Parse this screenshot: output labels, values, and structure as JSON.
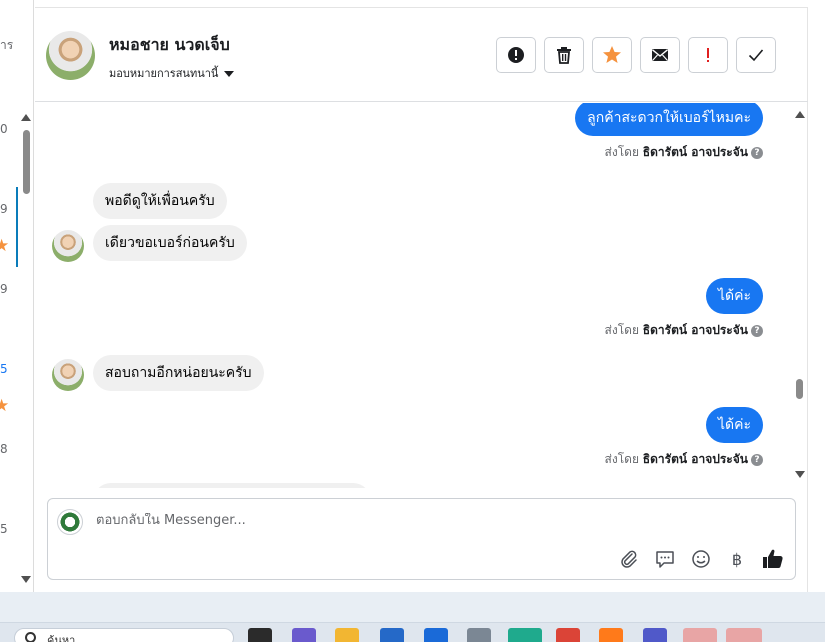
{
  "left_list": {
    "header_fragment": "าร",
    "row_times": [
      "0",
      "9",
      "9",
      "5",
      "8",
      "5"
    ],
    "blue_index": 3
  },
  "conversation": {
    "name": "หมอชาย นวดเจ็บ",
    "assign_label": "มอบหมายการสนทนานี้",
    "toolbar": {
      "spam_icon": "alert-circle-icon",
      "trash_icon": "trash-icon",
      "star_icon": "star-icon",
      "mail_icon": "envelope-icon",
      "important_icon": "exclamation-icon",
      "done_icon": "check-icon"
    }
  },
  "messages": [
    {
      "direction": "out",
      "text": "ลูกค้าสะดวกให้เบอร์ไหมคะ",
      "sent_prefix": "ส่งโดย",
      "sent_by": "ธิดารัตน์ อาจประจัน"
    },
    {
      "direction": "in",
      "text": "พอดีดูให้เพื่อนครับ"
    },
    {
      "direction": "in",
      "text": "เดียวขอเบอร์ก่อนครับ"
    },
    {
      "direction": "out",
      "text": "ได้ค่ะ",
      "sent_prefix": "ส่งโดย",
      "sent_by": "ธิดารัตน์ อาจประจัน"
    },
    {
      "direction": "in",
      "text": "สอบถามอีกหน่อยนะครับ"
    },
    {
      "direction": "out",
      "text": "ได้ค่ะ",
      "sent_prefix": "ส่งโดย",
      "sent_by": "ธิดารัตน์ อาจประจัน"
    }
  ],
  "composer": {
    "placeholder": "ตอบกลับใน Messenger...",
    "icons": [
      "paperclip-icon",
      "speech-bubble-icon",
      "smiley-icon",
      "baht-icon",
      "thumbs-up-icon"
    ],
    "baht_symbol": "฿"
  },
  "taskbar": {
    "search_text": "ค้นหา"
  },
  "colors": {
    "accent": "#1877f2",
    "star": "#f5923e",
    "important": "#e02020"
  }
}
